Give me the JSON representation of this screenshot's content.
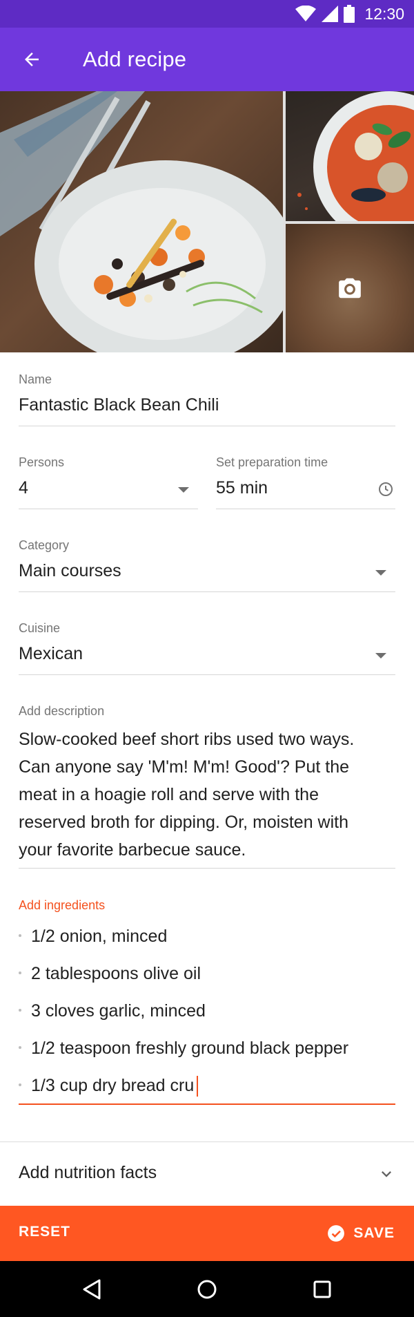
{
  "status_bar": {
    "time": "12:30",
    "icons": [
      "wifi-icon",
      "cellular-icon",
      "battery-icon"
    ]
  },
  "app_bar": {
    "title": "Add recipe",
    "back_icon": "arrow-back-icon",
    "color": "#7038dd"
  },
  "gallery": {
    "photos": [
      "main-dish-photo",
      "soup-photo",
      "add-photo-tile"
    ],
    "add_photo_icon": "camera-icon"
  },
  "form": {
    "name": {
      "label": "Name",
      "value": "Fantastic Black Bean Chili"
    },
    "persons": {
      "label": "Persons",
      "value": "4"
    },
    "prep_time": {
      "label": "Set preparation time",
      "value": "55 min",
      "icon": "clock-icon"
    },
    "category": {
      "label": "Category",
      "value": "Main courses"
    },
    "cuisine": {
      "label": "Cuisine",
      "value": "Mexican"
    },
    "description": {
      "label": "Add description",
      "lines": [
        "Slow-cooked beef short ribs used two ways.",
        "Can anyone say 'M'm! M'm! Good'? Put the",
        "meat in a hoagie roll and serve with the",
        "reserved broth for dipping. Or, moisten with",
        "your favorite barbecue sauce."
      ]
    },
    "ingredients": {
      "label": "Add ingredients",
      "items": [
        "1/2 onion, minced",
        "2 tablespoons olive oil",
        "3 cloves garlic, minced",
        "1/2 teaspoon freshly ground black pepper"
      ],
      "input_value": "1/3 cup dry bread cru",
      "accent": "#f4511e"
    }
  },
  "nutrition": {
    "label": "Add nutrition facts",
    "icon": "chevron-down-icon"
  },
  "actions": {
    "reset": "RESET",
    "save": "SAVE",
    "save_icon": "check-circle-icon",
    "color": "#ff5722"
  },
  "nav": {
    "icons": [
      "nav-back-icon",
      "nav-home-icon",
      "nav-recents-icon"
    ]
  }
}
